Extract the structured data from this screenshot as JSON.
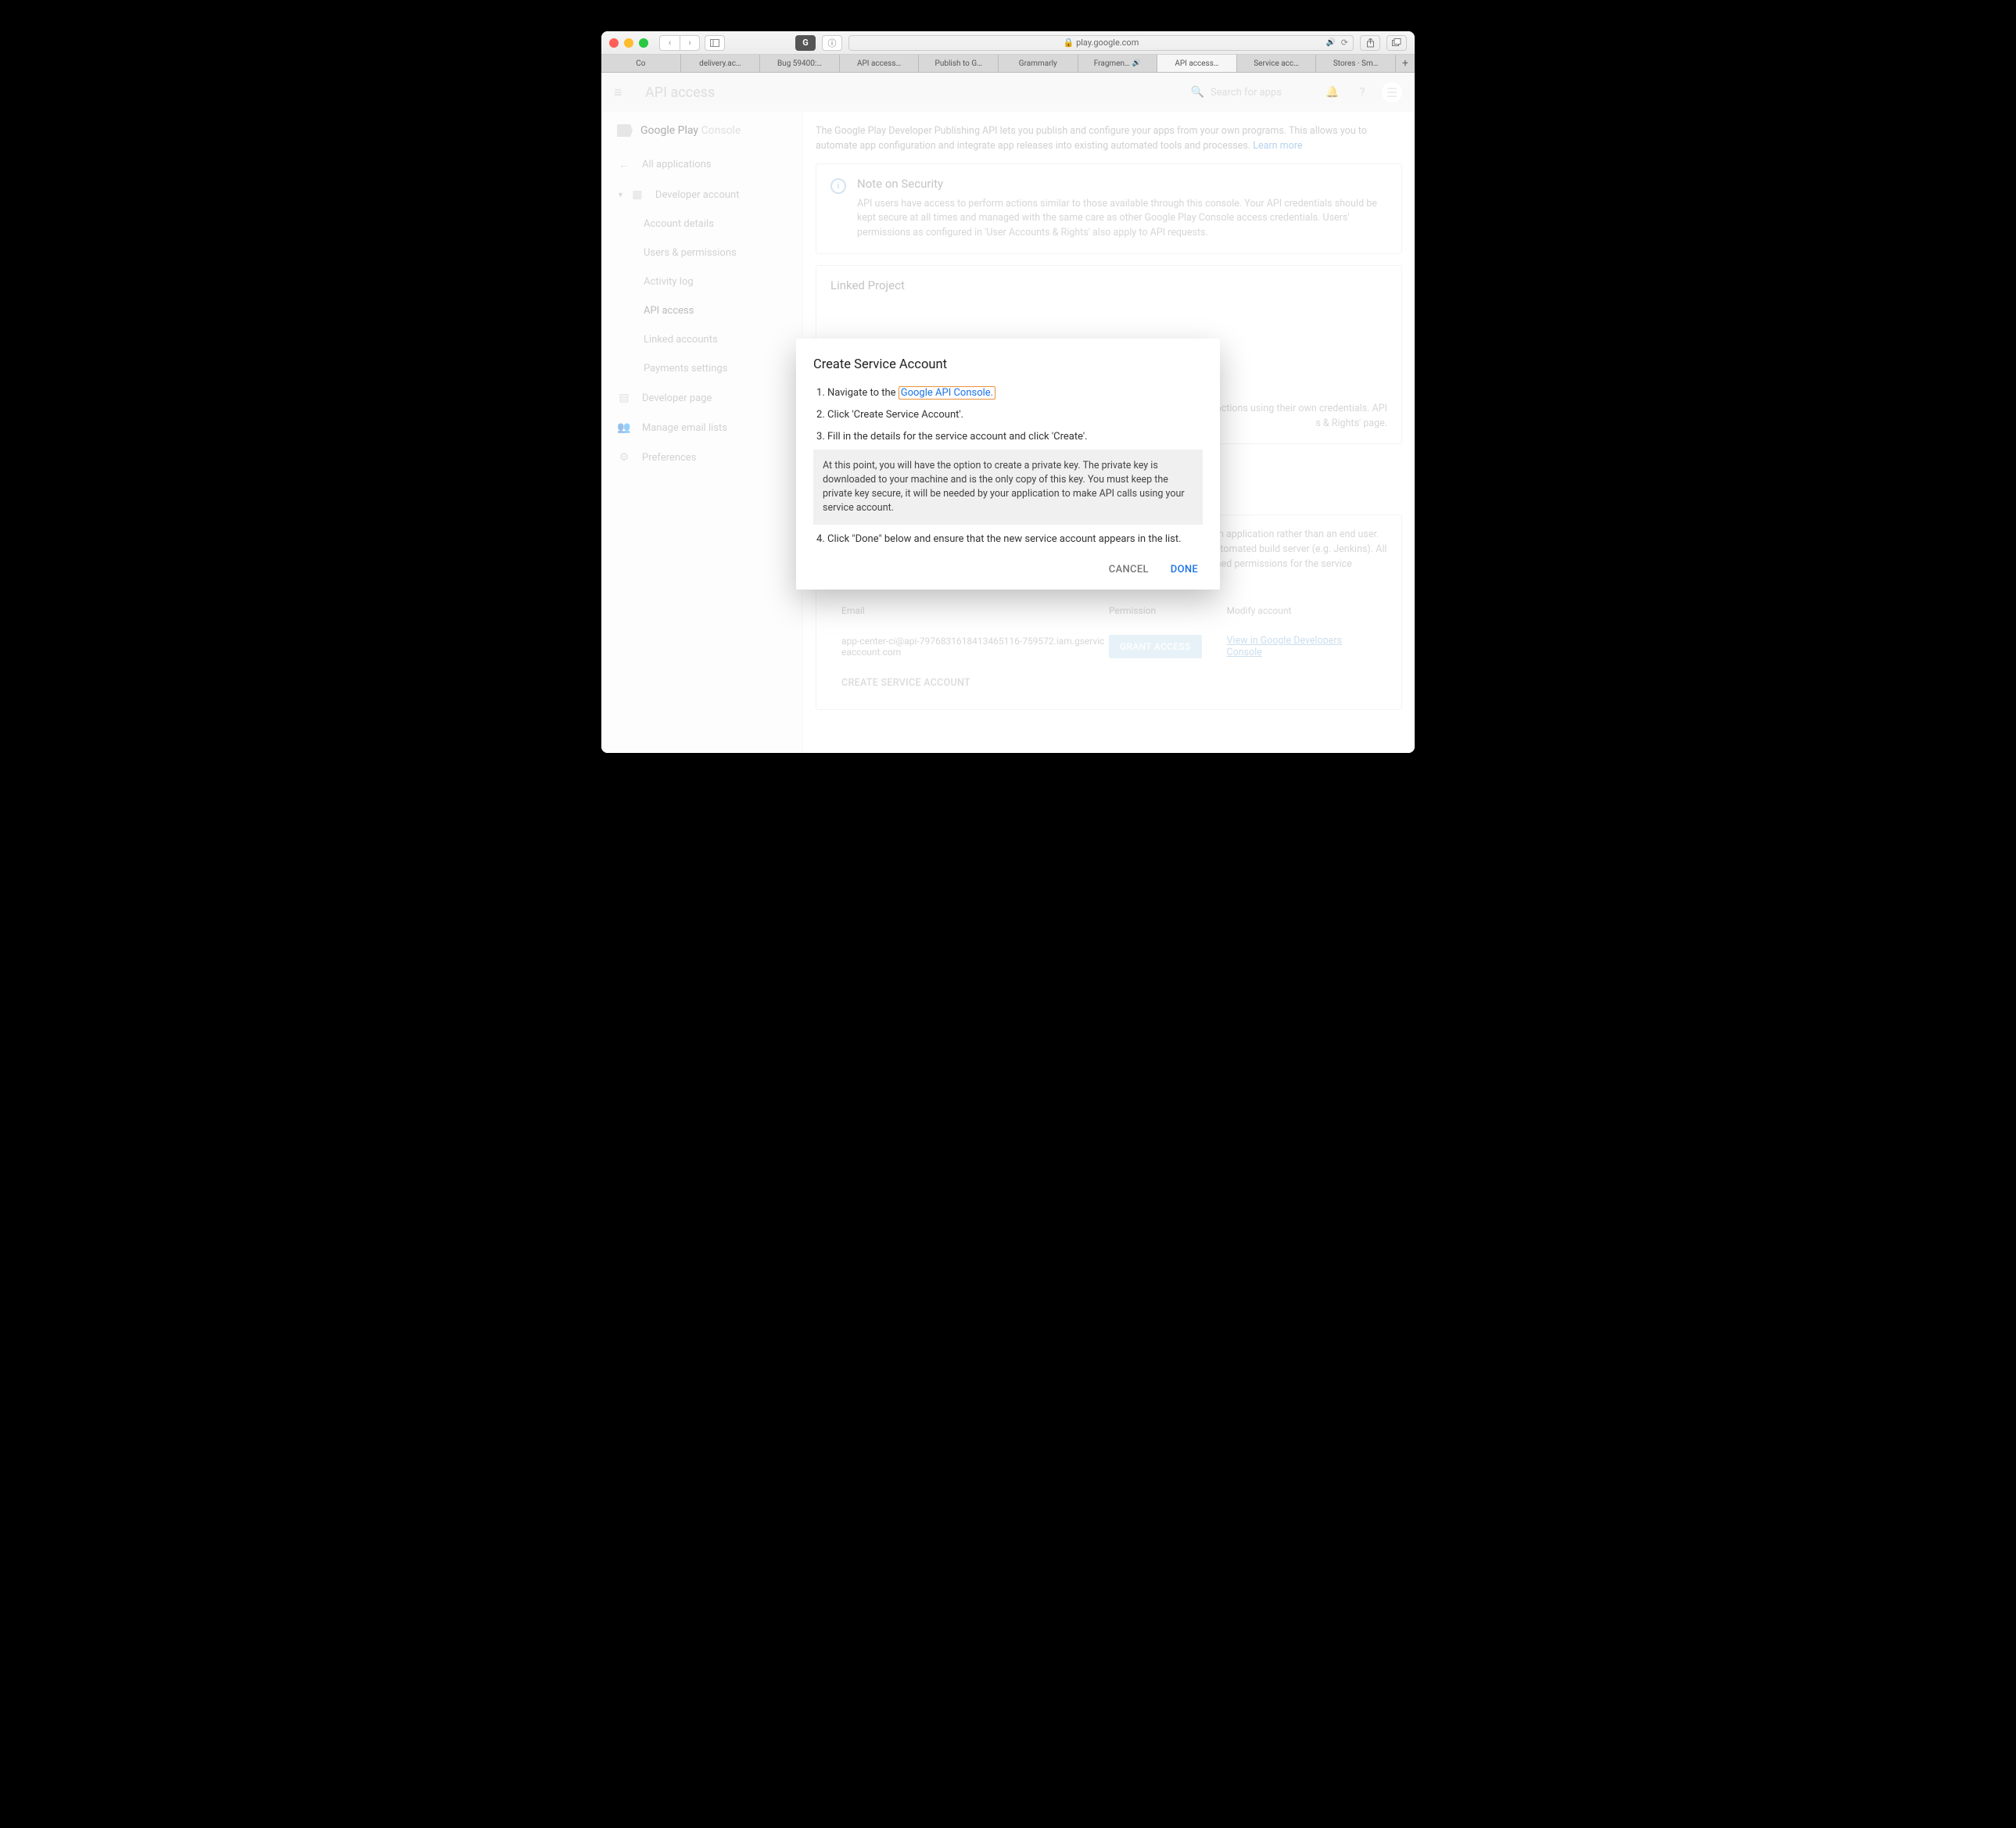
{
  "browser": {
    "url": "play.google.com",
    "lock": "🔒",
    "tabs": [
      {
        "label": "Co"
      },
      {
        "label": "delivery.ac…"
      },
      {
        "label": "Bug 59400:…"
      },
      {
        "label": "API access…"
      },
      {
        "label": "Publish to G…"
      },
      {
        "label": "Grammarly"
      },
      {
        "label": "Fragmen…",
        "sound": true
      },
      {
        "label": "API access…",
        "active": true
      },
      {
        "label": "Service acc…"
      },
      {
        "label": "Stores · Sm…"
      }
    ]
  },
  "header": {
    "title": "API access",
    "search_placeholder": "Search for apps"
  },
  "sidebar": {
    "logo1": "Google Play ",
    "logo2": "Console",
    "all_apps": "All applications",
    "dev_account": "Developer account",
    "items": [
      "Account details",
      "Users & permissions",
      "Activity log",
      "API access",
      "Linked accounts",
      "Payments settings"
    ],
    "dev_page": "Developer page",
    "email_lists": "Manage email lists",
    "prefs": "Preferences"
  },
  "main": {
    "intro": "The Google Play Developer Publishing API lets you publish and configure your apps from your own programs. This allows you to automate app configuration and integrate app releases into existing automated tools and processes. ",
    "learn_more": "Learn more",
    "security": {
      "title": "Note on Security",
      "body": "API users have access to perform actions similar to those available through this console. Your API credentials should be kept secure at all times and managed with the same care as other Google Play Console access credentials. Users' permissions as configured in 'User Accounts & Rights' also apply to API requests."
    },
    "linked": {
      "title": "Linked Project",
      "partial": "actions using their own credentials. API",
      "partial2": "s & Rights' page."
    },
    "service": {
      "body": "Service accounts allow access to the Google Play Developer Publishing API on behalf of an application rather than an end user. Service accounts are ideal for accessing the API from an unattended server, such as an automated build server (e.g. Jenkins). All actions will be shown as originating from the service account. You can configure fine grained permissions for the service account on the 'User Accounts & Rights' page.",
      "col_email": "Email",
      "col_perm": "Permission",
      "col_mod": "Modify account",
      "row_email": "app-center-ci@api-7976831618413465116-759572.iam.gserviceaccount.com",
      "grant": "GRANT ACCESS",
      "view": "View in Google Developers Console",
      "create": "CREATE SERVICE ACCOUNT"
    }
  },
  "dialog": {
    "title": "Create Service Account",
    "step1_a": "Navigate to the ",
    "step1_link": "Google API Console.",
    "step2": "Click 'Create Service Account'.",
    "step3": "Fill in the details for the service account and click 'Create'.",
    "note": "At this point, you will have the option to create a private key. The private key is downloaded to your machine and is the only copy of this key. You must keep the private key secure, it will be needed by your application to make API calls using your service account.",
    "step4": "Click \"Done\" below and ensure that the new service account appears in the list.",
    "cancel": "CANCEL",
    "done": "DONE"
  }
}
